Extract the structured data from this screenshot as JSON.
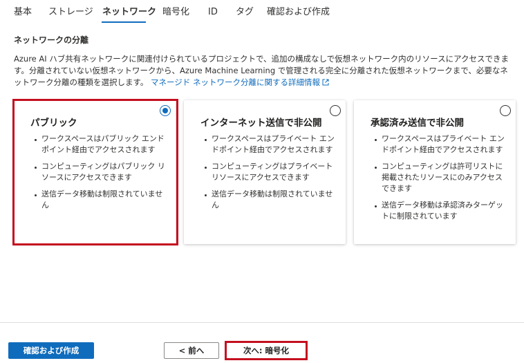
{
  "tabs": [
    {
      "label": "基本"
    },
    {
      "label": "ストレージ"
    },
    {
      "label": "ネットワーク"
    },
    {
      "label": "暗号化"
    },
    {
      "label": "ID"
    },
    {
      "label": "タグ"
    },
    {
      "label": "確認および作成"
    }
  ],
  "active_tab": "ネットワーク",
  "section_title": "ネットワークの分離",
  "description": {
    "text": "Azure AI ハブ共有ネットワークに関連付けられているプロジェクトで、追加の構成なしで仮想ネットワーク内のリソースにアクセスできます。分離されていない仮想ネットワークから、Azure Machine Learning で管理される完全に分離された仮想ネットワークまで、必要なネットワーク分離の種類を選択します。",
    "link": "マネージド ネットワーク分離に関する詳細情報"
  },
  "options": [
    {
      "title": "パブリック",
      "selected": true,
      "bullets": [
        "ワークスペースはパブリック エンドポイント経由でアクセスされます",
        "コンピューティングはパブリック リソースにアクセスできます",
        "送信データ移動は制限されていません"
      ]
    },
    {
      "title": "インターネット送信で非公開",
      "selected": false,
      "bullets": [
        "ワークスペースはプライベート エンドポイント経由でアクセスされます",
        "コンピューティングはプライベート リソースにアクセスできます",
        "送信データ移動は制限されていません"
      ]
    },
    {
      "title": "承認済み送信で非公開",
      "selected": false,
      "bullets": [
        "ワークスペースはプライベート エンドポイント経由でアクセスされます",
        "コンピューティングは許可リストに掲載されたリソースにのみアクセスできます",
        "送信データ移動は承認済みターゲットに制限されています"
      ]
    }
  ],
  "footer": {
    "review_create": "確認および作成",
    "prev": "< 前へ",
    "next": "次へ: 暗号化"
  },
  "colors": {
    "accent": "#0f6cbd",
    "highlight": "#c50f1f"
  }
}
